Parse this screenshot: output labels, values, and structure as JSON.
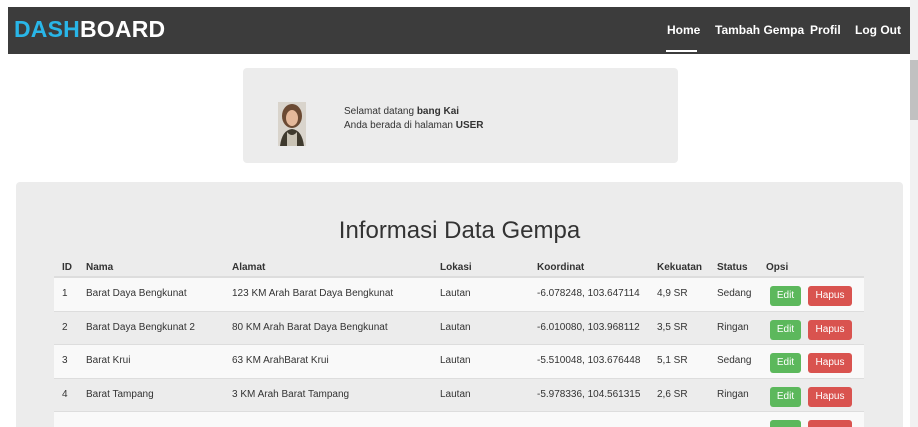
{
  "navbar": {
    "brand_accent": "DASH",
    "brand_rest": "BOARD",
    "links": [
      "Home",
      "Tambah Gempa",
      "Profil",
      "Log Out"
    ]
  },
  "welcome": {
    "greeting_prefix": "Selamat datang ",
    "user_name": "bang Kai",
    "page_prefix": "Anda berada di halaman ",
    "page_name": "USER"
  },
  "panel": {
    "title": "Informasi Data Gempa"
  },
  "table": {
    "headers": [
      "ID",
      "Nama",
      "Alamat",
      "Lokasi",
      "Koordinat",
      "Kekuatan",
      "Status",
      "Opsi"
    ],
    "edit_label": "Edit",
    "delete_label": "Hapus",
    "rows": [
      [
        "1",
        "Barat Daya Bengkunat",
        "123 KM Arah Barat Daya Bengkunat",
        "Lautan",
        "-6.078248, 103.647114",
        "4,9 SR",
        "Sedang"
      ],
      [
        "2",
        "Barat Daya Bengkunat 2",
        "80 KM Arah Barat Daya Bengkunat",
        "Lautan",
        "-6.010080, 103.968112",
        "3,5 SR",
        "Ringan"
      ],
      [
        "3",
        "Barat Krui",
        "63 KM ArahBarat Krui",
        "Lautan",
        "-5.510048, 103.676448",
        "5,1 SR",
        "Sedang"
      ],
      [
        "4",
        "Barat Tampang",
        "3 KM Arah Barat Tampang",
        "Lautan",
        "-5.978336, 104.561315",
        "2,6 SR",
        "Ringan"
      ]
    ]
  },
  "colors": {
    "navbar_bg": "#3c3c3c",
    "brand_accent": "#29b6e8",
    "edit_button": "#5cb85c",
    "delete_button": "#d9534f"
  }
}
